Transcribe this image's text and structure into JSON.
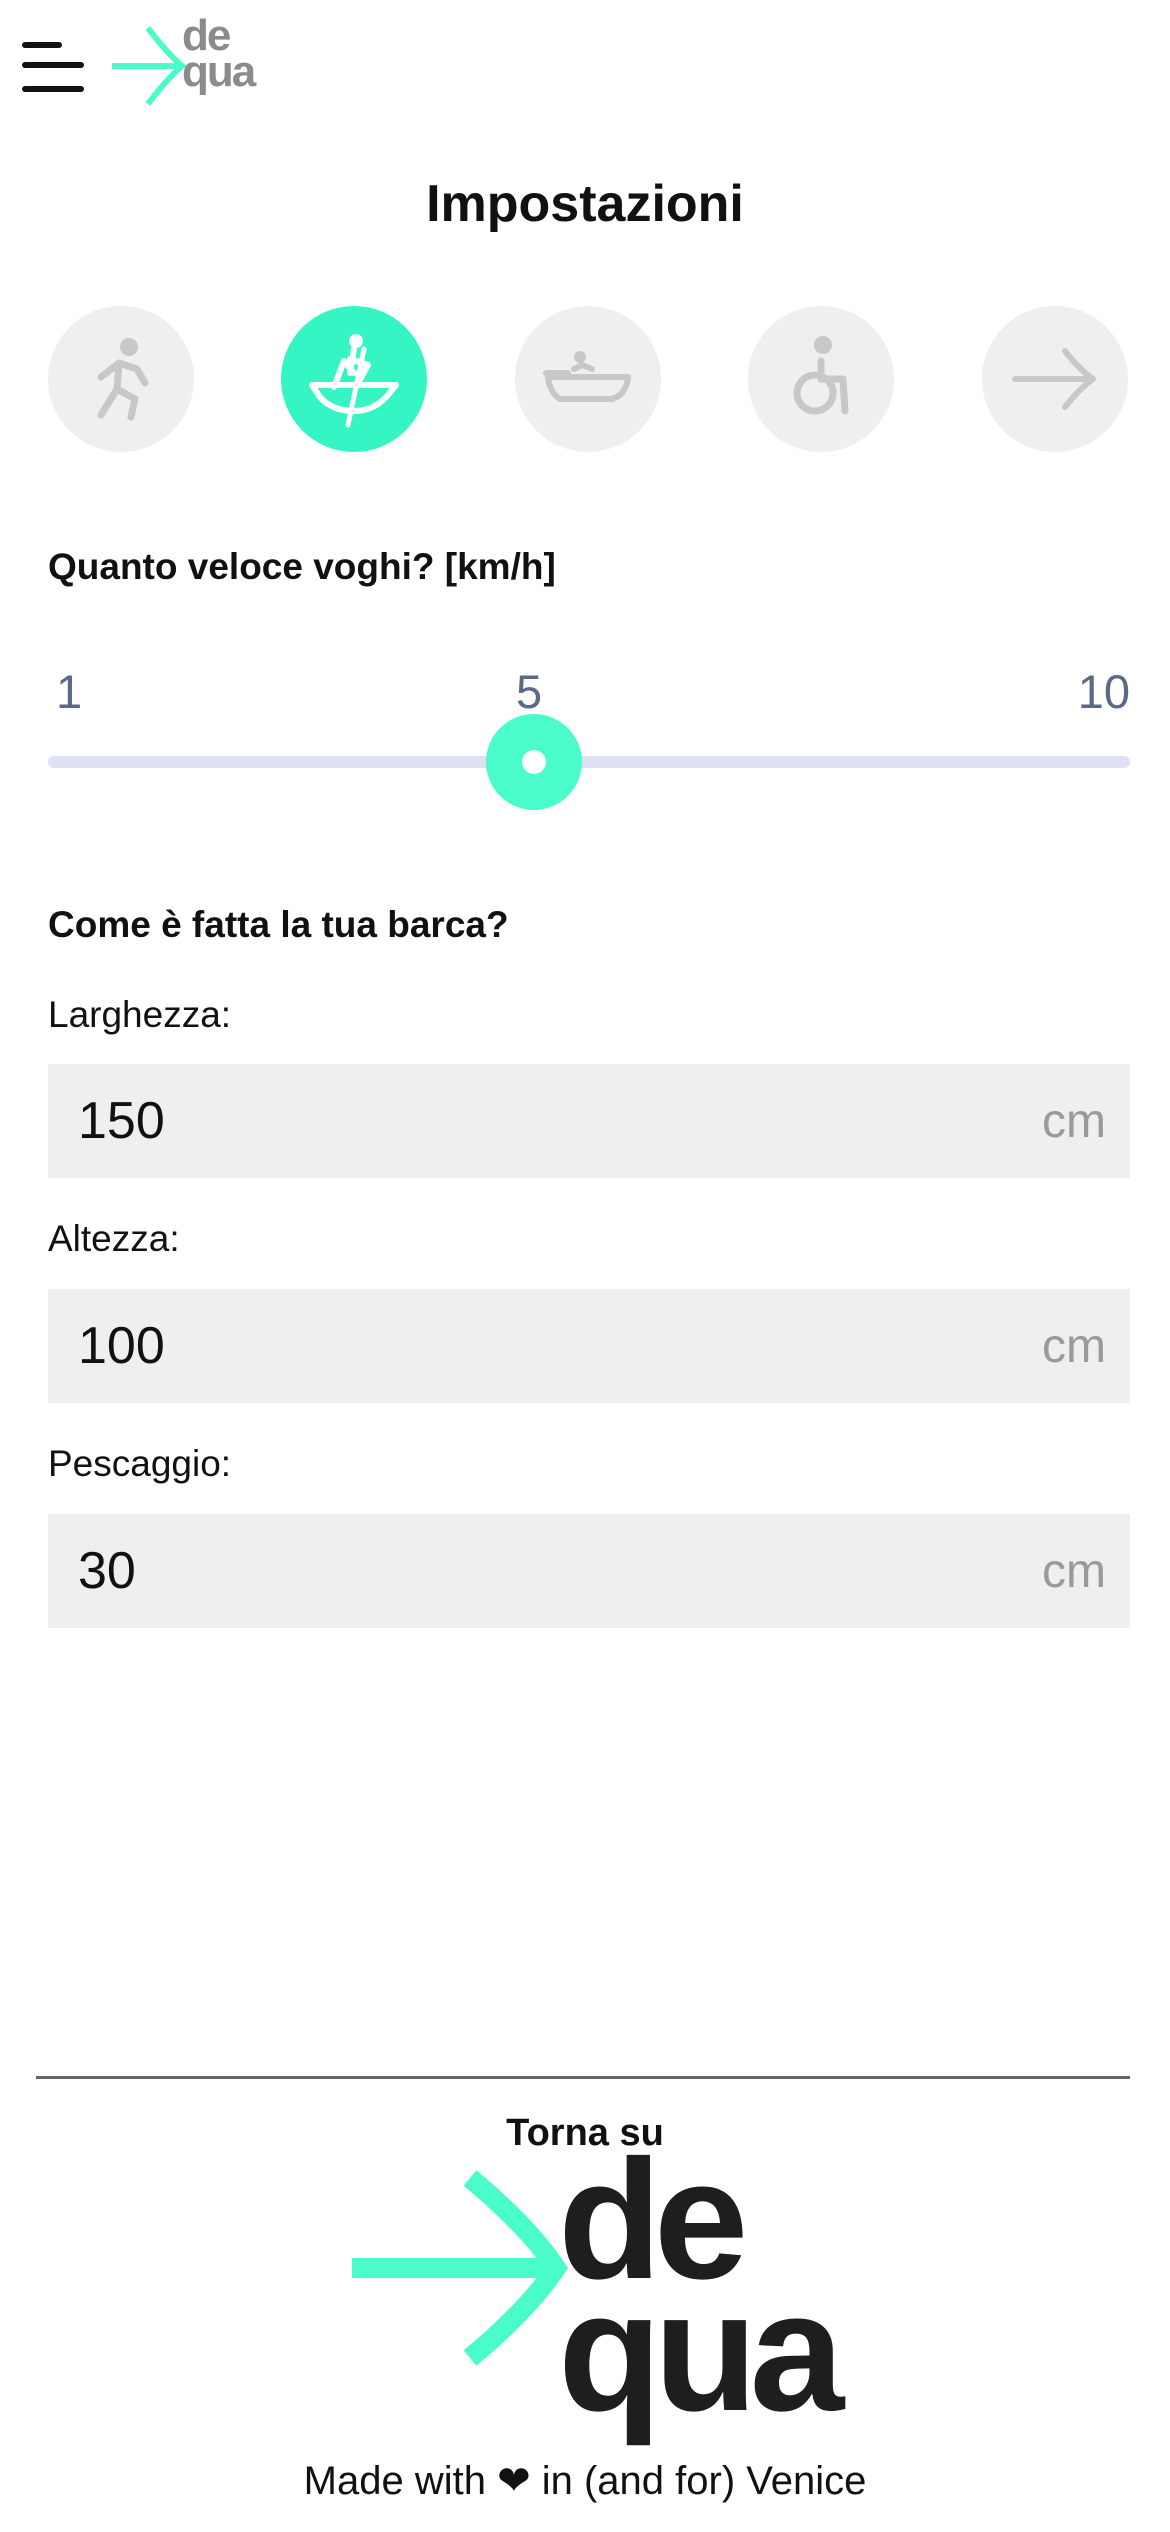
{
  "header": {
    "menu_icon": "hamburger-menu-icon",
    "logo_line1": "de",
    "logo_line2": "qua",
    "accent": "#36f5c5"
  },
  "page_title": "Impostazioni",
  "modes": [
    {
      "icon": "walking-icon",
      "active": false
    },
    {
      "icon": "rowing-boat-icon",
      "active": true
    },
    {
      "icon": "motor-boat-icon",
      "active": false
    },
    {
      "icon": "wheelchair-icon",
      "active": false
    },
    {
      "icon": "arrow-right-icon",
      "active": false
    }
  ],
  "speed": {
    "question": "Quanto veloce voghi? [km/h]",
    "min_label": "1",
    "mid_label": "5",
    "max_label": "10",
    "value": 5
  },
  "boat": {
    "question": "Come è fatta la tua barca?",
    "width": {
      "label": "Larghezza:",
      "value": "150",
      "unit": "cm"
    },
    "height": {
      "label": "Altezza:",
      "value": "100",
      "unit": "cm"
    },
    "draft": {
      "label": "Pescaggio:",
      "value": "30",
      "unit": "cm"
    }
  },
  "footer": {
    "back_to_top": "Torna su",
    "logo_line1": "de",
    "logo_line2": "qua",
    "made_with_prefix": "Made with",
    "heart_icon": "heart-icon",
    "made_with_suffix": "in (and for) Venice"
  }
}
